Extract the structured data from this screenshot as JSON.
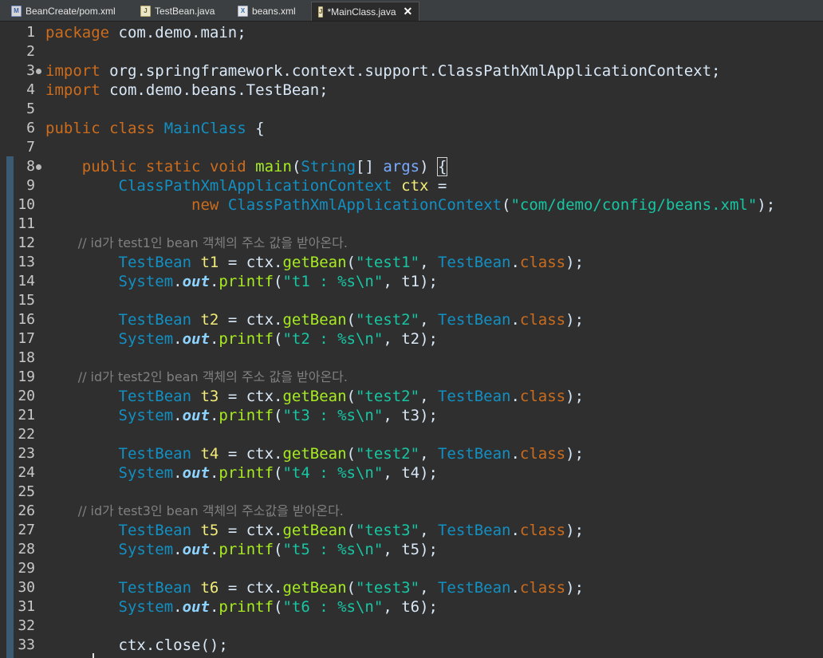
{
  "tabs": [
    {
      "label": "BeanCreate/pom.xml",
      "icon": "maven-file-icon",
      "glyph": "M"
    },
    {
      "label": "TestBean.java",
      "icon": "java-file-icon",
      "glyph": "J"
    },
    {
      "label": "beans.xml",
      "icon": "xml-file-icon",
      "glyph": "X"
    },
    {
      "label": "*MainClass.java",
      "icon": "java-file-icon",
      "glyph": "J",
      "close": "✕"
    }
  ],
  "line_numbers": [
    "1",
    "2",
    "3",
    "4",
    "5",
    "6",
    "7",
    "8",
    "9",
    "10",
    "11",
    "12",
    "13",
    "14",
    "15",
    "16",
    "17",
    "18",
    "19",
    "20",
    "21",
    "22",
    "23",
    "24",
    "25",
    "26",
    "27",
    "28",
    "29",
    "30",
    "31",
    "32",
    "33"
  ],
  "code": {
    "l1": {
      "kw": "package",
      "rest": " com.demo.main;"
    },
    "l3": {
      "kw": "import",
      "rest": " org.springframework.context.support.ClassPathXmlApplicationContext;"
    },
    "l4": {
      "kw": "import",
      "rest": " com.demo.beans.TestBean;"
    },
    "l6": {
      "kw1": "public",
      "kw2": "class",
      "cls": "MainClass",
      "rest": " {"
    },
    "l8": {
      "kw1": "public",
      "kw2": "static",
      "kw3": "void",
      "fn": "main",
      "p1": "(",
      "type": "String",
      "p2": "[] ",
      "param": "args",
      "p3": ") ",
      "brace": "{"
    },
    "l9": {
      "type": "ClassPathXmlApplicationContext",
      "var": "ctx",
      "rest": " ="
    },
    "l10": {
      "kw": "new",
      "type": "ClassPathXmlApplicationContext",
      "p1": "(",
      "str": "\"com/demo/config/beans.xml\"",
      "p2": ");"
    },
    "c12": "// id가 test1인 bean 객체의 주소 값을 받아온다.",
    "c19": "// id가 test2인 bean 객체의 주소 값을 받아온다.",
    "c26": "// id가 test3인 bean 객체의 주소값을 받아온다.",
    "getbean": [
      {
        "type": "TestBean",
        "var": "t1",
        "eq": " = ctx.",
        "fn": "getBean",
        "p1": "(",
        "str": "\"test1\"",
        "comma": ", ",
        "type2": "TestBean",
        "dot": ".",
        "kw": "class",
        "end": ");"
      },
      {
        "type": "TestBean",
        "var": "t2",
        "eq": " = ctx.",
        "fn": "getBean",
        "p1": "(",
        "str": "\"test2\"",
        "comma": ", ",
        "type2": "TestBean",
        "dot": ".",
        "kw": "class",
        "end": ");"
      },
      {
        "type": "TestBean",
        "var": "t3",
        "eq": " = ctx.",
        "fn": "getBean",
        "p1": "(",
        "str": "\"test2\"",
        "comma": ", ",
        "type2": "TestBean",
        "dot": ".",
        "kw": "class",
        "end": ");"
      },
      {
        "type": "TestBean",
        "var": "t4",
        "eq": " = ctx.",
        "fn": "getBean",
        "p1": "(",
        "str": "\"test2\"",
        "comma": ", ",
        "type2": "TestBean",
        "dot": ".",
        "kw": "class",
        "end": ");"
      },
      {
        "type": "TestBean",
        "var": "t5",
        "eq": " = ctx.",
        "fn": "getBean",
        "p1": "(",
        "str": "\"test3\"",
        "comma": ", ",
        "type2": "TestBean",
        "dot": ".",
        "kw": "class",
        "end": ");"
      },
      {
        "type": "TestBean",
        "var": "t6",
        "eq": " = ctx.",
        "fn": "getBean",
        "p1": "(",
        "str": "\"test3\"",
        "comma": ", ",
        "type2": "TestBean",
        "dot": ".",
        "kw": "class",
        "end": ");"
      }
    ],
    "printf": [
      {
        "type": "System",
        "dot": ".",
        "stat": "out",
        "dot2": ".",
        "fn": "printf",
        "p1": "(",
        "str": "\"t1 : %s\\n\"",
        "rest": ", t1);"
      },
      {
        "type": "System",
        "dot": ".",
        "stat": "out",
        "dot2": ".",
        "fn": "printf",
        "p1": "(",
        "str": "\"t2 : %s\\n\"",
        "rest": ", t2);"
      },
      {
        "type": "System",
        "dot": ".",
        "stat": "out",
        "dot2": ".",
        "fn": "printf",
        "p1": "(",
        "str": "\"t3 : %s\\n\"",
        "rest": ", t3);"
      },
      {
        "type": "System",
        "dot": ".",
        "stat": "out",
        "dot2": ".",
        "fn": "printf",
        "p1": "(",
        "str": "\"t4 : %s\\n\"",
        "rest": ", t4);"
      },
      {
        "type": "System",
        "dot": ".",
        "stat": "out",
        "dot2": ".",
        "fn": "printf",
        "p1": "(",
        "str": "\"t5 : %s\\n\"",
        "rest": ", t5);"
      },
      {
        "type": "System",
        "dot": ".",
        "stat": "out",
        "dot2": ".",
        "fn": "printf",
        "p1": "(",
        "str": "\"t6 : %s\\n\"",
        "rest": ", t6);"
      }
    ],
    "l33": "ctx.close();"
  },
  "colors": {
    "keyword": "#cc6c1d",
    "type": "#1290c3",
    "method": "#a7ec21",
    "string": "#17c6a3",
    "variable": "#f3ec79",
    "comment": "#808080",
    "background": "#2f2f2f"
  }
}
